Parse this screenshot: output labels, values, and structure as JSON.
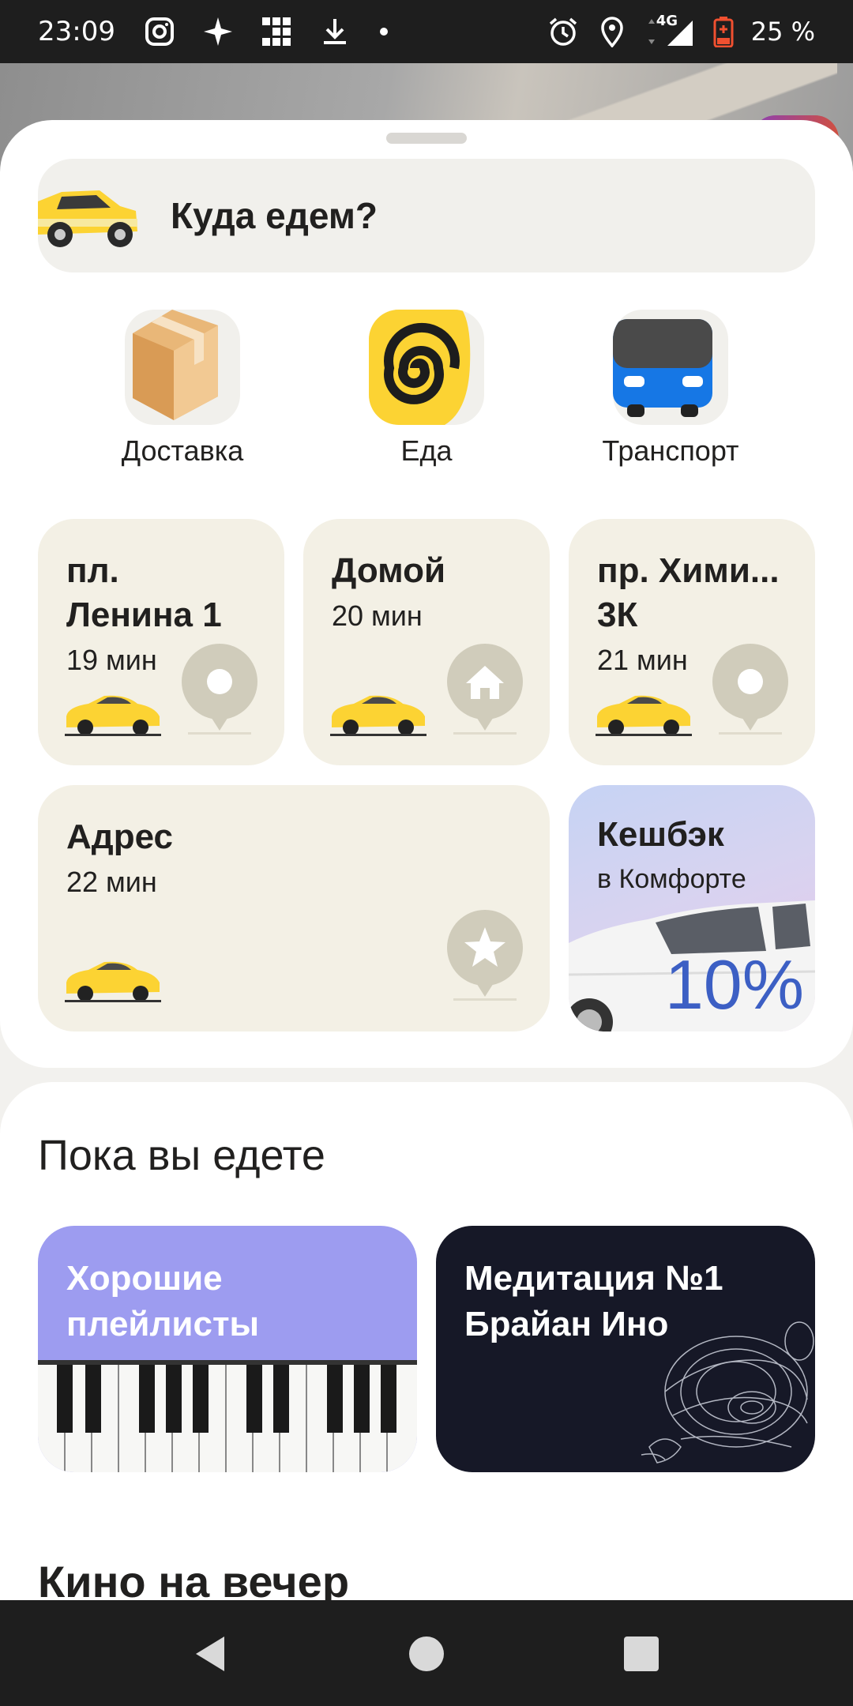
{
  "status_bar": {
    "time": "23:09",
    "network": "4G",
    "battery": "25 %",
    "left_icons": [
      "instagram-icon",
      "sparkle-icon",
      "grid-icon",
      "download-icon",
      "dot-icon"
    ],
    "right_icons": [
      "alarm-icon",
      "location-icon",
      "signal-icon",
      "battery-icon"
    ]
  },
  "search": {
    "placeholder": "Куда едем?"
  },
  "services": [
    {
      "label": "Доставка",
      "icon": "box-icon"
    },
    {
      "label": "Еда",
      "icon": "spiral-icon"
    },
    {
      "label": "Транспорт",
      "icon": "bus-icon"
    }
  ],
  "destinations": [
    {
      "title_line1": "пл.",
      "title_line2": "Ленина 1",
      "eta": "19 мин",
      "icon": "pin-icon"
    },
    {
      "title_line1": "Домой",
      "eta": "20 мин",
      "icon": "home-icon"
    },
    {
      "title_line1": "пр. Хими...",
      "title_line2": "3К",
      "eta": "21 мин",
      "icon": "pin-icon"
    },
    {
      "title_line1": "Адрес",
      "eta": "22 мин",
      "icon": "star-icon"
    }
  ],
  "cashback": {
    "title": "Кешбэк",
    "subtitle": "в Комфорте",
    "value": "10%"
  },
  "while_riding": {
    "heading": "Пока вы едете",
    "cards": [
      {
        "line1": "Хорошие",
        "line2": "плейлисты",
        "bg": "#9d9cf0"
      },
      {
        "line1": "Медитация №1",
        "line2": "Брайан Ино",
        "bg": "#161827"
      }
    ]
  },
  "next_section": {
    "heading": "Кино на вечер"
  },
  "colors": {
    "card_bg": "#f3f0e5",
    "taxi_yellow": "#fcd333",
    "cashback_blue": "#3c5fc4"
  }
}
